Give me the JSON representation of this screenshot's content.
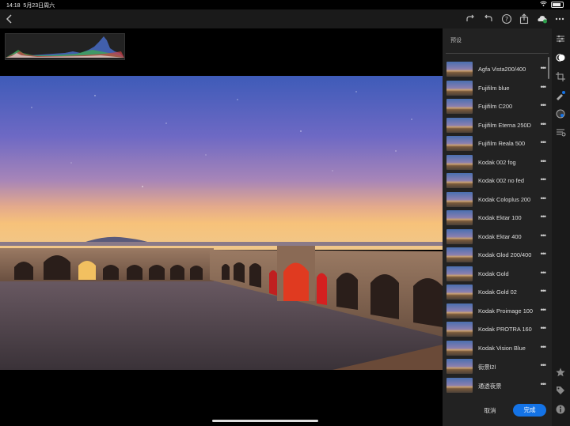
{
  "status": {
    "time": "14:18",
    "date": "5月23日周六"
  },
  "panel": {
    "title": "预设",
    "cancel_label": "取消",
    "done_label": "完成",
    "more_glyph": "•••",
    "presets": [
      "Agfa Vista200/400",
      "Fujifilm blue",
      "Fujifilm C200",
      "Fujifilm Eterna 250D",
      "Fujifilm Reala 500",
      "Kodak 002 fog",
      "Kodak 002 no fed",
      "Kodak Coloplus 200",
      "Kodak Ektar 100",
      "Kodak Ektar 400",
      "Kodak Glod 200/400",
      "Kodak Gold",
      "Kodak Gold 02",
      "Kodak Proimage 100",
      "Kodak PROTRA 160",
      "Kodak Vision Blue",
      "街景l2l",
      "通透夜景"
    ]
  },
  "colors": {
    "accent": "#1473e6",
    "panel_bg": "#222222",
    "toolbar_bg": "#1a1a1a"
  },
  "icons": {
    "back": "chevron-left-icon",
    "redo": "redo-icon",
    "undo": "undo-icon",
    "help": "help-icon",
    "share": "share-icon",
    "cloud": "cloud-sync-icon",
    "more": "more-icon",
    "rail": [
      "sliders-icon",
      "presets-icon",
      "crop-icon",
      "healing-icon",
      "masking-icon",
      "versions-icon",
      "star-icon",
      "tag-icon",
      "info-icon"
    ]
  }
}
